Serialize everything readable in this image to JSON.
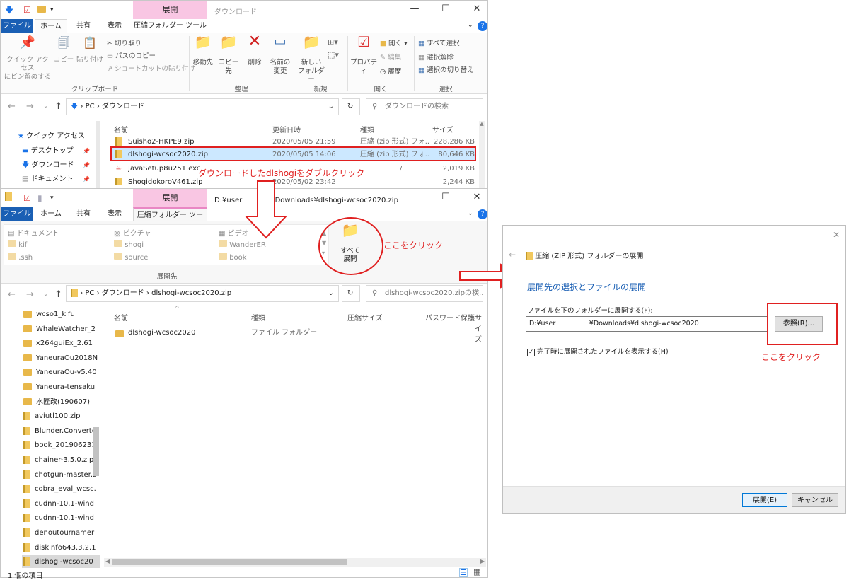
{
  "top_window": {
    "context_tab": "展開",
    "title": "ダウンロード",
    "tabs": [
      "ファイル",
      "ホーム",
      "共有",
      "表示",
      "圧縮フォルダー ツール"
    ],
    "ribbon": {
      "clipboard": {
        "pin": "クイック アクセス\nにピン留めする",
        "copy": "コピー",
        "paste": "貼り付け",
        "cut": "切り取り",
        "copy_path": "パスのコピー",
        "paste_shortcut": "ショートカットの貼り付け",
        "group": "クリップボード"
      },
      "organize": {
        "move": "移動先",
        "copyto": "コピー先",
        "delete": "削除",
        "rename": "名前の\n変更",
        "group": "整理"
      },
      "new": {
        "new_folder": "新しい\nフォルダー",
        "group": "新規"
      },
      "open": {
        "properties": "プロパティ",
        "open": "開く",
        "edit": "編集",
        "history": "履歴",
        "group": "開く"
      },
      "select": {
        "select_all": "すべて選択",
        "select_none": "選択解除",
        "invert": "選択の切り替え",
        "group": "選択"
      }
    },
    "address": {
      "pc": "PC",
      "folder": "ダウンロード",
      "search_placeholder": "ダウンロードの検索"
    },
    "columns": [
      "名前",
      "更新日時",
      "種類",
      "サイズ"
    ],
    "sidebar": [
      "クイック アクセス",
      "デスクトップ",
      "ダウンロード",
      "ドキュメント"
    ],
    "files": [
      {
        "name": "Suisho2-HKPE9.zip",
        "date": "2020/05/05 21:59",
        "type": "圧縮 (zip 形式) フォ...",
        "size": "228,286 KB"
      },
      {
        "name": "dlshogi-wcsoc2020.zip",
        "date": "2020/05/05 14:06",
        "type": "圧縮 (zip 形式) フォ...",
        "size": "80,646 KB"
      },
      {
        "name": "JavaSetup8u251.exe",
        "date": "",
        "type": "/",
        "size": "2,019 KB"
      },
      {
        "name": "ShogidokoroV461.zip",
        "date": "2020/05/02 23:42",
        "type": "",
        "size": "2,244 KB"
      }
    ]
  },
  "bottom_window": {
    "context_tab": "展開",
    "title": "D:¥user　　　　¥Downloads¥dlshogi-wcsoc2020.zip",
    "tabs": [
      "ファイル",
      "ホーム",
      "共有",
      "表示",
      "圧縮フォルダー ツール"
    ],
    "destinations": [
      [
        "ドキュメント",
        "kif",
        ".ssh"
      ],
      [
        "ピクチャ",
        "shogi",
        "source"
      ],
      [
        "ビデオ",
        "WanderER",
        "book"
      ]
    ],
    "extract_all": "すべて\n展開",
    "group": "展開先",
    "address": {
      "pc": "PC",
      "folder": "ダウンロード",
      "zip": "dlshogi-wcsoc2020.zip",
      "search_placeholder": "dlshogi-wcsoc2020.zipの検..."
    },
    "columns": [
      "名前",
      "種類",
      "圧縮サイズ",
      "パスワード保護",
      "サイズ"
    ],
    "row": {
      "name": "dlshogi-wcsoc2020",
      "type": "ファイル フォルダー"
    },
    "sidebar": [
      "wcso1_kifu",
      "WhaleWatcher_2",
      "x264guiEx_2.61",
      "YaneuraOu2018N",
      "YaneuraOu-v5.40",
      "Yaneura-tensaku",
      "水匠改(190607)",
      "aviutl100.zip",
      "Blunder.Converte",
      "book_201906231",
      "chainer-3.5.0.zip",
      "chotgun-master.z",
      "cobra_eval_wcsc.",
      "cudnn-10.1-wind",
      "cudnn-10.1-wind",
      "denoutournamer",
      "diskinfo643.3.2.1",
      "dlshogi-wcsoc20"
    ],
    "status": "1 個の項目"
  },
  "dialog": {
    "title": "圧縮 (ZIP 形式) フォルダーの展開",
    "heading": "展開先の選択とファイルの展開",
    "label": "ファイルを下のフォルダーに展開する(F):",
    "path": "D:¥user　　　　　¥Downloads¥dlshogi-wcsoc2020",
    "browse": "参照(R)...",
    "checkbox": "完了時に展開されたファイルを表示する(H)",
    "extract": "展開(E)",
    "cancel": "キャンセル"
  },
  "annotations": {
    "double_click": "ダウンロードしたdlshogiをダブルクリック",
    "click1": "ここをクリック",
    "click2": "ここをクリック"
  },
  "colors": {
    "file_tab": "#1a5fb4",
    "context": "#f9c6e3",
    "annotation": "#e02020",
    "heading": "#1a5fb4"
  }
}
